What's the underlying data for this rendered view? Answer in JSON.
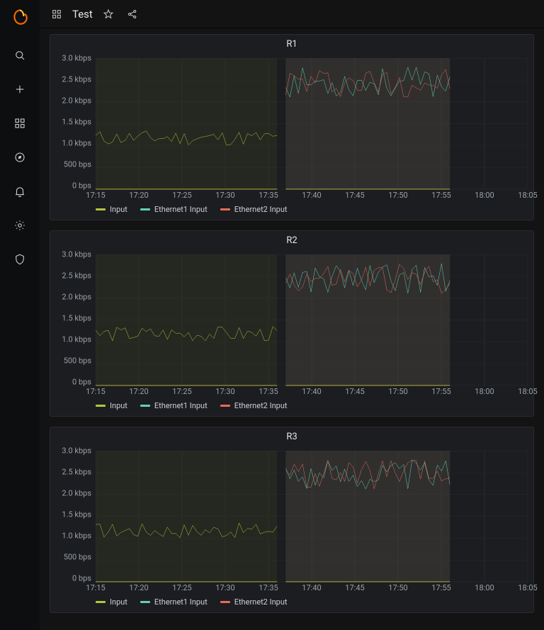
{
  "header": {
    "title": "Test"
  },
  "sidebar": {
    "items": [
      "search",
      "create",
      "dashboards",
      "explore",
      "alerting",
      "configuration",
      "admin"
    ]
  },
  "chart_meta": {
    "ylabels": [
      "0 bps",
      "500 bps",
      "1.0 kbps",
      "1.5 kbps",
      "2.0 kbps",
      "2.5 kbps",
      "3.0 kbps"
    ],
    "xlabels": [
      "17:15",
      "17:20",
      "17:25",
      "17:30",
      "17:35",
      "17:40",
      "17:45",
      "17:50",
      "17:55",
      "18:00",
      "18:05"
    ],
    "legend": {
      "input": "Input",
      "eth1": "Ethernet1 Input",
      "eth2": "Ethernet2 Input"
    },
    "colors": {
      "input": "#b6c53b",
      "eth1": "#60d3b6",
      "eth2": "#e86c58"
    }
  },
  "chart_data": [
    {
      "title": "R1",
      "type": "line",
      "ylim": [
        0,
        3000
      ],
      "ylabel": "",
      "xlabel": "",
      "categories": [
        "17:15",
        "17:20",
        "17:25",
        "17:30",
        "17:35",
        "17:40",
        "17:45",
        "17:50",
        "17:55",
        "18:00",
        "18:05"
      ],
      "input_region": {
        "xstart": "17:15",
        "xend": "17:36"
      },
      "eth_region": {
        "xstart": "17:37",
        "xend": "17:56"
      },
      "series": [
        {
          "name": "Input",
          "color": "#b6c53b",
          "approx_range": [
            1000,
            1350
          ],
          "active": "17:15-17:36"
        },
        {
          "name": "Ethernet1 Input",
          "color": "#60d3b6",
          "approx_range": [
            2100,
            2800
          ],
          "active": "17:37-17:56"
        },
        {
          "name": "Ethernet2 Input",
          "color": "#e86c58",
          "approx_range": [
            2100,
            2800
          ],
          "active": "17:37-17:56"
        }
      ]
    },
    {
      "title": "R2",
      "type": "line",
      "ylim": [
        0,
        3000
      ],
      "ylabel": "",
      "xlabel": "",
      "categories": [
        "17:15",
        "17:20",
        "17:25",
        "17:30",
        "17:35",
        "17:40",
        "17:45",
        "17:50",
        "17:55",
        "18:00",
        "18:05"
      ],
      "input_region": {
        "xstart": "17:15",
        "xend": "17:36"
      },
      "eth_region": {
        "xstart": "17:37",
        "xend": "17:56"
      },
      "series": [
        {
          "name": "Input",
          "color": "#b6c53b",
          "approx_range": [
            1000,
            1350
          ],
          "active": "17:15-17:36"
        },
        {
          "name": "Ethernet1 Input",
          "color": "#60d3b6",
          "approx_range": [
            2100,
            2800
          ],
          "active": "17:37-17:56"
        },
        {
          "name": "Ethernet2 Input",
          "color": "#e86c58",
          "approx_range": [
            2100,
            2800
          ],
          "active": "17:37-17:56"
        }
      ]
    },
    {
      "title": "R3",
      "type": "line",
      "ylim": [
        0,
        3000
      ],
      "ylabel": "",
      "xlabel": "",
      "categories": [
        "17:15",
        "17:20",
        "17:25",
        "17:30",
        "17:35",
        "17:40",
        "17:45",
        "17:50",
        "17:55",
        "18:00",
        "18:05"
      ],
      "input_region": {
        "xstart": "17:15",
        "xend": "17:36"
      },
      "eth_region": {
        "xstart": "17:37",
        "xend": "17:56"
      },
      "series": [
        {
          "name": "Input",
          "color": "#b6c53b",
          "approx_range": [
            1000,
            1350
          ],
          "active": "17:15-17:36"
        },
        {
          "name": "Ethernet1 Input",
          "color": "#60d3b6",
          "approx_range": [
            2100,
            2800
          ],
          "active": "17:37-17:56"
        },
        {
          "name": "Ethernet2 Input",
          "color": "#e86c58",
          "approx_range": [
            2100,
            2800
          ],
          "active": "17:37-17:56"
        }
      ]
    }
  ]
}
